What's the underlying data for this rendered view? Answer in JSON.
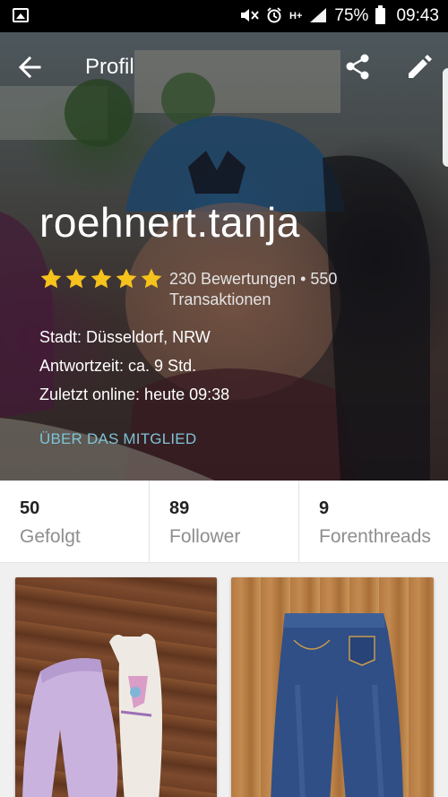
{
  "status_bar": {
    "battery": "75%",
    "time": "09:43",
    "network": "H+"
  },
  "app_bar": {
    "title": "Profil"
  },
  "profile": {
    "username": "roehnert.tanja",
    "rating_stars": 5,
    "ratings_text": "230 Bewertungen • 550 Transaktionen",
    "city": "Stadt: Düsseldorf, NRW",
    "response_time": "Antwortzeit:  ca. 9 Std.",
    "last_online": "Zuletzt online: heute 09:38",
    "about_link": "ÜBER DAS MITGLIED",
    "colors": {
      "star": "#f6c21c",
      "about_link": "#7ec3d6"
    }
  },
  "stats": [
    {
      "count": "50",
      "label": "Gefolgt"
    },
    {
      "count": "89",
      "label": "Follower"
    },
    {
      "count": "9",
      "label": "Forenthreads"
    }
  ],
  "icons": {
    "back": "arrow-left-icon",
    "share": "share-icon",
    "edit": "pencil-icon",
    "star": "star-icon"
  }
}
